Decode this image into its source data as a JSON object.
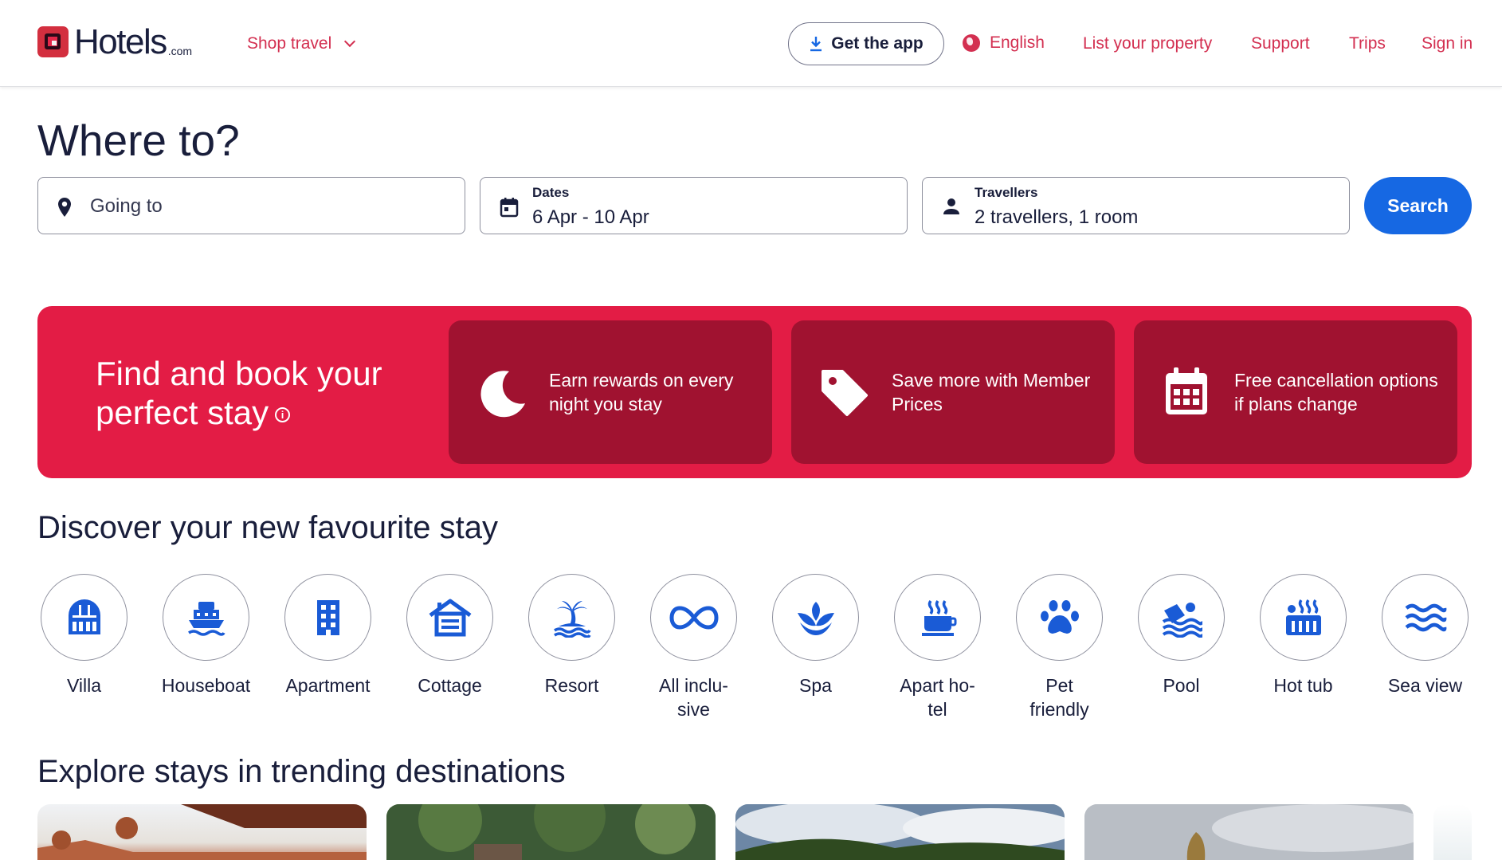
{
  "header": {
    "brand": "Hotels",
    "brand_suffix": ".com",
    "shop_travel": "Shop travel",
    "get_app": "Get the app",
    "language": "English",
    "list_property": "List your property",
    "support": "Support",
    "trips": "Trips",
    "sign_in": "Sign in"
  },
  "search": {
    "title": "Where to?",
    "destination_placeholder": "Going to",
    "dates_label": "Dates",
    "dates_value": "6 Apr - 10 Apr",
    "travellers_label": "Travellers",
    "travellers_value": "2 travellers, 1 room",
    "search_button": "Search"
  },
  "banner": {
    "title": "Find and book your perfect stay",
    "info_icon": "info-icon",
    "benefits": [
      {
        "icon": "moon-icon",
        "text": "Earn rewards on every night you stay"
      },
      {
        "icon": "tag-icon",
        "text": "Save more with Member Prices"
      },
      {
        "icon": "calendar-icon",
        "text": "Free cancellation options if plans change"
      }
    ],
    "colors": {
      "background": "#e31c45",
      "card": "#a01230"
    }
  },
  "discover": {
    "title": "Discover your new favourite stay",
    "categories": [
      {
        "label": "Villa",
        "icon": "villa-icon"
      },
      {
        "label": "Houseboat",
        "icon": "houseboat-icon"
      },
      {
        "label": "Apartment",
        "icon": "apartment-icon"
      },
      {
        "label": "Cottage",
        "icon": "cottage-icon"
      },
      {
        "label": "Resort",
        "icon": "resort-icon"
      },
      {
        "label": "All inclu-\nsive",
        "icon": "all-inclusive-icon"
      },
      {
        "label": "Spa",
        "icon": "spa-icon"
      },
      {
        "label": "Apart ho-\ntel",
        "icon": "aparthotel-icon"
      },
      {
        "label": "Pet\nfriendly",
        "icon": "pet-friendly-icon"
      },
      {
        "label": "Pool",
        "icon": "pool-icon"
      },
      {
        "label": "Hot tub",
        "icon": "hot-tub-icon"
      },
      {
        "label": "Sea view",
        "icon": "sea-view-icon"
      }
    ]
  },
  "trending": {
    "title": "Explore stays in trending destinations"
  },
  "colors": {
    "accent": "#d32f50",
    "primary_blue": "#1668e3",
    "icon_blue": "#1a5bd6",
    "text": "#191e3b"
  }
}
